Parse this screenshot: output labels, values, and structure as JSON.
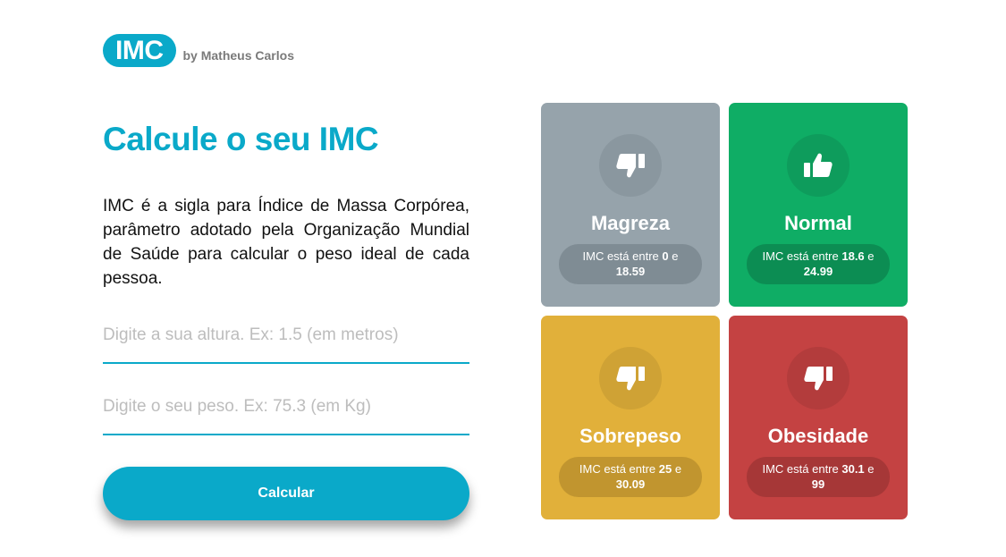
{
  "header": {
    "logo": "IMC",
    "byline": "by Matheus Carlos"
  },
  "main": {
    "title": "Calcule o seu IMC",
    "description": "IMC é a sigla para Índice de Massa Corpórea, parâmetro adotado pela Organização Mundial de Saúde para calcular o peso ideal de cada pessoa.",
    "height_placeholder": "Digite a sua altura. Ex: 1.5 (em metros)",
    "weight_placeholder": "Digite o seu peso. Ex: 75.3 (em Kg)",
    "height_value": "",
    "weight_value": "",
    "calc_label": "Calcular"
  },
  "cards": [
    {
      "title": "Magreza",
      "prefix": "IMC está entre ",
      "min": "0",
      "joiner": " e ",
      "max": "18.59",
      "icon": "thumbs-down-icon",
      "color": "#96a3ab",
      "circle": "#8a979f",
      "pill": "#7f8c94"
    },
    {
      "title": "Normal",
      "prefix": "IMC está entre ",
      "min": "18.6",
      "joiner": " e ",
      "max": "24.99",
      "icon": "thumbs-up-icon",
      "color": "#0fad65",
      "circle": "#0e9c5c",
      "pill": "#0c8d53"
    },
    {
      "title": "Sobrepeso",
      "prefix": "IMC está entre ",
      "min": "25",
      "joiner": " e ",
      "max": "30.09",
      "icon": "thumbs-down-icon",
      "color": "#e1b03a",
      "circle": "#cfa235",
      "pill": "#c1952f"
    },
    {
      "title": "Obesidade",
      "prefix": "IMC está entre ",
      "min": "30.1",
      "joiner": " e ",
      "max": "99",
      "icon": "thumbs-down-icon",
      "color": "#c44242",
      "circle": "#b33c3c",
      "pill": "#a63737"
    }
  ]
}
